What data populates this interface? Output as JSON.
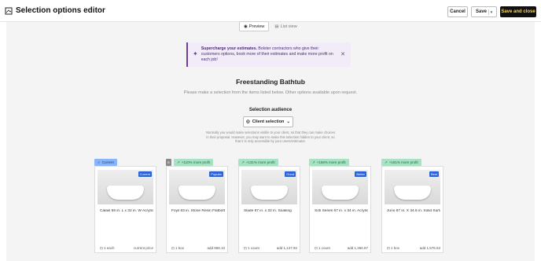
{
  "header": {
    "title": "Selection options editor",
    "cancel_label": "Cancel",
    "save_label": "Save",
    "save_close_label": "Save and close"
  },
  "view_toggle": {
    "preview_label": "Preview",
    "list_label": "List view"
  },
  "banner": {
    "strong": "Supercharge your estimates.",
    "text": " Bolster contractors who give their customers options, book more of their estimates and make more profit on each job!"
  },
  "product": {
    "title": "Freestanding Bathtub",
    "subtitle": "Please make a selection from the items listed below. Other options available upon request."
  },
  "audience": {
    "title": "Selection audience",
    "value": "Client selection",
    "help": "Normally you would make selections visible to your client, so that they can make choices in their proposal. However, you may want to make this selection hidden to your client, so that it is only accessible by your users/estimator."
  },
  "options": [
    {
      "tag": "Current",
      "tag_type": "current",
      "badge": "Current",
      "name": "Calais 55 in. L x 32 in. W Acrylic",
      "qty": "1 each",
      "price": "current price"
    },
    {
      "tag": "+110% more profit",
      "tag_type": "profit",
      "badge": "Popular",
      "name": "Foyil 63 in. Stone Resin Flatbottom",
      "qty": "1 box",
      "price": "add 958.10",
      "box_tag": "B"
    },
    {
      "tag": "+131% more profit",
      "tag_type": "profit",
      "badge": "Good",
      "name": "Slade 67 in. x 32 in. Soaking",
      "qty": "1 count",
      "price": "add 1,137.92"
    },
    {
      "tag": "+156% more profit",
      "tag_type": "profit",
      "badge": "Better",
      "name": "Sofi Series 67 in. x 34 in. Acrylic",
      "qty": "1 count",
      "price": "add 1,366.87"
    },
    {
      "tag": "+181% more profit",
      "tag_type": "profit",
      "badge": "Best",
      "name": "Juno 67 in. X 34.6 in. Solid Surface",
      "qty": "1 box",
      "price": "add 1,576.53"
    }
  ]
}
